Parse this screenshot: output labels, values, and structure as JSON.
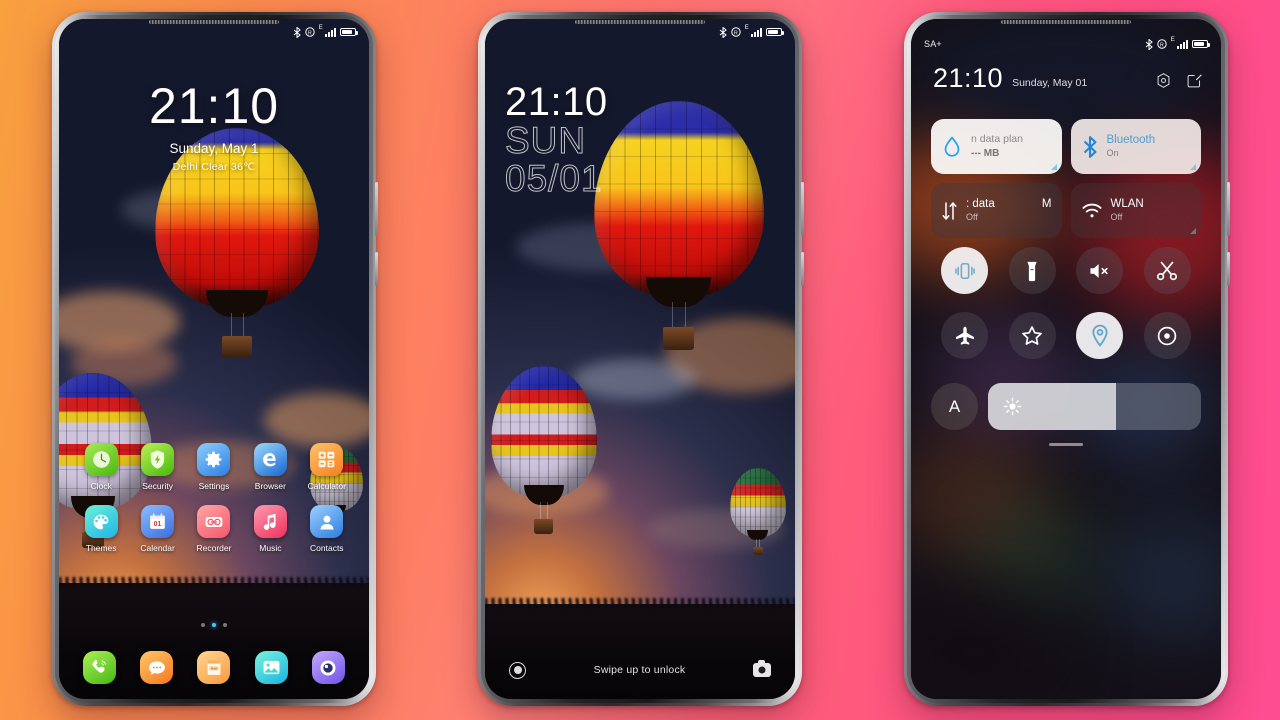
{
  "background": {
    "left_color": "#F9A03F",
    "right_color": "#FF4D92"
  },
  "phones": [
    {
      "id": "phone-home-screen",
      "kind": "home-screen",
      "status_bar": {
        "left_text": "",
        "icons": [
          "bluetooth-icon",
          "ring-silent-icon",
          "signal-e-icon",
          "battery-icon"
        ],
        "network_type": "E"
      },
      "clock": {
        "time": "21:10",
        "date": "Sunday, May 1",
        "weather": "Delhi  Clear  36℃"
      },
      "apps_row1": [
        {
          "label": "Clock",
          "icon": "clock-icon",
          "c1": "#9ee34a",
          "c2": "#57c21f"
        },
        {
          "label": "Security",
          "icon": "shield-icon",
          "c1": "#b4ee4f",
          "c2": "#4fbe13"
        },
        {
          "label": "Settings",
          "icon": "gear-icon",
          "c1": "#7ec5fb",
          "c2": "#2f84e8"
        },
        {
          "label": "Browser",
          "icon": "browser-e-icon",
          "c1": "#8fd2fb",
          "c2": "#1e73d8"
        },
        {
          "label": "Calculator",
          "icon": "calculator-icon",
          "c1": "#ffb457",
          "c2": "#f77a20"
        }
      ],
      "apps_row2": [
        {
          "label": "Themes",
          "icon": "palette-icon",
          "c1": "#5fe0d0",
          "c2": "#2fb8e6"
        },
        {
          "label": "Calendar",
          "icon": "calendar-icon",
          "c1": "#7fb6ff",
          "c2": "#3a6fe0"
        },
        {
          "label": "Recorder",
          "icon": "recorder-icon",
          "c1": "#ff9e9e",
          "c2": "#f45a6a"
        },
        {
          "label": "Music",
          "icon": "music-icon",
          "c1": "#ff93ac",
          "c2": "#f0395f"
        },
        {
          "label": "Contacts",
          "icon": "contacts-icon",
          "c1": "#8ec7ff",
          "c2": "#2a7fe0"
        }
      ],
      "page_dots": {
        "count": 3,
        "active_index": 1
      },
      "dock": [
        {
          "label": "Phone",
          "icon": "phone-icon",
          "c1": "#a6ee4d",
          "c2": "#49bb17"
        },
        {
          "label": "Messages",
          "icon": "message-icon",
          "c1": "#ffc15e",
          "c2": "#f57c2a"
        },
        {
          "label": "Notes",
          "icon": "notes-icon",
          "c1": "#ffd28a",
          "c2": "#f79a3d"
        },
        {
          "label": "Gallery",
          "icon": "gallery-icon",
          "c1": "#6ff0d6",
          "c2": "#20b6e0"
        },
        {
          "label": "Camera",
          "icon": "camera-eye-icon",
          "c1": "#b79bff",
          "c2": "#7c5fe8"
        }
      ]
    },
    {
      "id": "phone-lock-screen",
      "kind": "lock-screen",
      "status_bar": {
        "left_text": "",
        "icons": [
          "bluetooth-icon",
          "ring-silent-icon",
          "signal-e-icon",
          "battery-icon"
        ],
        "network_type": "E"
      },
      "clock": {
        "time": "21:10",
        "day_of_week": "SUN",
        "date": "05/01"
      },
      "bottom": {
        "left_icon": "shortcut-circle-icon",
        "hint": "Swipe up to unlock",
        "right_icon": "camera-icon"
      }
    },
    {
      "id": "phone-control-center",
      "kind": "control-center",
      "status_bar": {
        "left_text": "SA+",
        "icons": [
          "bluetooth-icon",
          "ring-silent-icon",
          "signal-e-icon",
          "battery-icon"
        ],
        "network_type": "E"
      },
      "header": {
        "time": "21:10",
        "date": "Sunday, May 01",
        "actions": [
          "settings-hex-icon",
          "edit-icon"
        ]
      },
      "tiles": [
        {
          "name": "data-plan-tile",
          "icon": "water-drop-icon",
          "title": "n data plan",
          "subtitle": "--- MB",
          "state": "on",
          "style": "light",
          "accent": "#1ba7f0"
        },
        {
          "name": "bluetooth-tile",
          "icon": "bluetooth-icon",
          "title": "Bluetooth",
          "subtitle": "On",
          "state": "on",
          "style": "light2",
          "accent": "#2196f3"
        },
        {
          "name": "mobile-data-tile",
          "icon": "data-transfer-icon",
          "title": ": data",
          "badge": "M",
          "subtitle": "Off",
          "state": "off",
          "style": "dark",
          "accent": "#ffffff"
        },
        {
          "name": "wlan-tile",
          "icon": "wifi-icon",
          "title": "WLAN",
          "subtitle": "Off",
          "state": "off",
          "style": "dark2",
          "accent": "#ffffff"
        }
      ],
      "toggles": [
        {
          "name": "vibrate-toggle",
          "icon": "vibrate-icon",
          "state": "on"
        },
        {
          "name": "flashlight-toggle",
          "icon": "flashlight-icon",
          "state": "off"
        },
        {
          "name": "mute-toggle",
          "icon": "volume-mute-icon",
          "state": "off"
        },
        {
          "name": "screenshot-toggle",
          "icon": "scissors-icon",
          "state": "off"
        },
        {
          "name": "airplane-toggle",
          "icon": "airplane-icon",
          "state": "off"
        },
        {
          "name": "favorites-toggle",
          "icon": "star-icon",
          "state": "off"
        },
        {
          "name": "location-toggle",
          "icon": "location-pin-icon",
          "state": "on"
        },
        {
          "name": "eye-comfort-toggle",
          "icon": "eye-icon",
          "state": "off"
        }
      ],
      "brightness": {
        "auto_label": "A",
        "icon": "sun-icon",
        "value_percent": 60
      },
      "drag_handle": "panel-drag-handle"
    }
  ]
}
